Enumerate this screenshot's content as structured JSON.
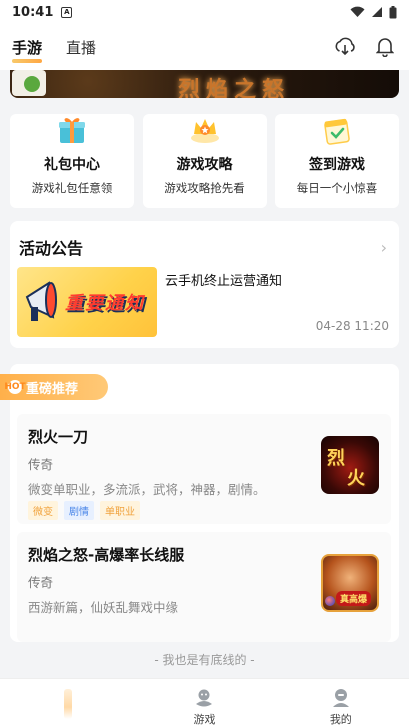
{
  "status_bar": {
    "time": "10:41"
  },
  "header": {
    "tabs": [
      "手游",
      "直播"
    ],
    "active_tab": 0
  },
  "banner": {
    "title": "烈焰之怒"
  },
  "quick_cards": [
    {
      "title": "礼包中心",
      "subtitle": "游戏礼包任意领",
      "icon": "gift-box-icon"
    },
    {
      "title": "游戏攻略",
      "subtitle": "游戏攻略抢先看",
      "icon": "crown-badge-icon"
    },
    {
      "title": "签到游戏",
      "subtitle": "每日一个小惊喜",
      "icon": "calendar-check-icon"
    }
  ],
  "notice": {
    "title": "活动公告",
    "image_text": "重要通知",
    "headline": "云手机终止运营通知",
    "date": "04-28 11:20"
  },
  "recommend": {
    "tag_label": "重磅推荐",
    "tag_icon_text": "HOT",
    "games": [
      {
        "title": "烈火一刀",
        "category": "传奇",
        "description": "微变单职业，多流派，武将，神器，剧情。",
        "tags": [
          "微变",
          "剧情",
          "单职业"
        ],
        "cover_text": [
          "烈",
          "火"
        ]
      },
      {
        "title": "烈焰之怒-高爆率长线服",
        "category": "传奇",
        "description": "西游新篇，仙妖乱舞戏中缘",
        "tags": [],
        "cover_text": [
          "真高爆"
        ]
      }
    ]
  },
  "footer_note": "- 我也是有底线的 -",
  "tabbar": [
    {
      "label": "",
      "icon": "home-icon"
    },
    {
      "label": "游戏",
      "icon": "gamepad-icon"
    },
    {
      "label": "我的",
      "icon": "profile-icon"
    }
  ],
  "colors": {
    "accent": "#ffb04a",
    "tag_blue": "#4a86e8",
    "tag_orange": "#f0a23c"
  }
}
